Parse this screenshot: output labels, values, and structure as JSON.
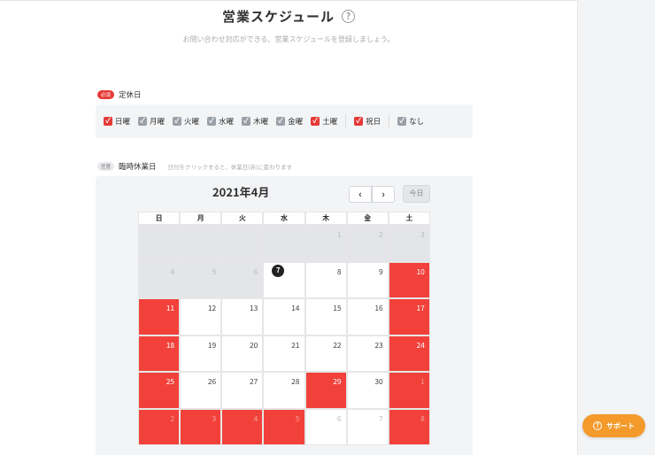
{
  "header": {
    "title": "営業スケジュール",
    "help_icon": "?",
    "subtitle": "お問い合わせ対応ができる、営業スケジュールを登録しましょう。"
  },
  "regular_holidays": {
    "badge": "必須",
    "label": "定休日",
    "items": [
      {
        "label": "日曜",
        "checked": true,
        "color": "red"
      },
      {
        "label": "月曜",
        "checked": true,
        "color": "gray"
      },
      {
        "label": "火曜",
        "checked": true,
        "color": "gray"
      },
      {
        "label": "水曜",
        "checked": true,
        "color": "gray"
      },
      {
        "label": "木曜",
        "checked": true,
        "color": "gray"
      },
      {
        "label": "金曜",
        "checked": true,
        "color": "gray"
      },
      {
        "label": "土曜",
        "checked": true,
        "color": "red"
      },
      {
        "label": "祝日",
        "checked": true,
        "color": "red"
      },
      {
        "label": "なし",
        "checked": true,
        "color": "gray"
      }
    ]
  },
  "temporary_holidays": {
    "badge": "任意",
    "label": "臨時休業日",
    "hint": "日付をクリックすると、休業日(赤)に変わります"
  },
  "calendar": {
    "month_label": "2021年4月",
    "prev_icon": "‹",
    "next_icon": "›",
    "today_label": "今日",
    "weekdays": [
      "日",
      "月",
      "火",
      "水",
      "木",
      "金",
      "土"
    ],
    "weeks": [
      [
        {
          "d": "",
          "s": "out"
        },
        {
          "d": "",
          "s": "out"
        },
        {
          "d": "",
          "s": "out"
        },
        {
          "d": "",
          "s": "out"
        },
        {
          "d": "1",
          "s": "out"
        },
        {
          "d": "2",
          "s": "out"
        },
        {
          "d": "3",
          "s": "out"
        }
      ],
      [
        {
          "d": "4",
          "s": "out"
        },
        {
          "d": "5",
          "s": "out"
        },
        {
          "d": "6",
          "s": "out"
        },
        {
          "d": "7",
          "s": "today"
        },
        {
          "d": "8",
          "s": "normal"
        },
        {
          "d": "9",
          "s": "normal"
        },
        {
          "d": "10",
          "s": "closed"
        }
      ],
      [
        {
          "d": "11",
          "s": "closed"
        },
        {
          "d": "12",
          "s": "normal"
        },
        {
          "d": "13",
          "s": "normal"
        },
        {
          "d": "14",
          "s": "normal"
        },
        {
          "d": "15",
          "s": "normal"
        },
        {
          "d": "16",
          "s": "normal"
        },
        {
          "d": "17",
          "s": "closed"
        }
      ],
      [
        {
          "d": "18",
          "s": "closed"
        },
        {
          "d": "19",
          "s": "normal"
        },
        {
          "d": "20",
          "s": "normal"
        },
        {
          "d": "21",
          "s": "normal"
        },
        {
          "d": "22",
          "s": "normal"
        },
        {
          "d": "23",
          "s": "normal"
        },
        {
          "d": "24",
          "s": "closed"
        }
      ],
      [
        {
          "d": "25",
          "s": "closed"
        },
        {
          "d": "26",
          "s": "normal"
        },
        {
          "d": "27",
          "s": "normal"
        },
        {
          "d": "28",
          "s": "normal"
        },
        {
          "d": "29",
          "s": "closed"
        },
        {
          "d": "30",
          "s": "normal"
        },
        {
          "d": "1",
          "s": "closed-out"
        }
      ],
      [
        {
          "d": "2",
          "s": "closed-out"
        },
        {
          "d": "3",
          "s": "closed-out"
        },
        {
          "d": "4",
          "s": "closed-out"
        },
        {
          "d": "5",
          "s": "closed-out"
        },
        {
          "d": "6",
          "s": "normal-out"
        },
        {
          "d": "7",
          "s": "normal-out"
        },
        {
          "d": "8",
          "s": "closed-out"
        }
      ]
    ]
  },
  "support": {
    "label": "サポート",
    "icon": "?"
  },
  "colors": {
    "closed": "#f1413a",
    "support": "#f39a2b",
    "required_badge": "#e53935"
  }
}
